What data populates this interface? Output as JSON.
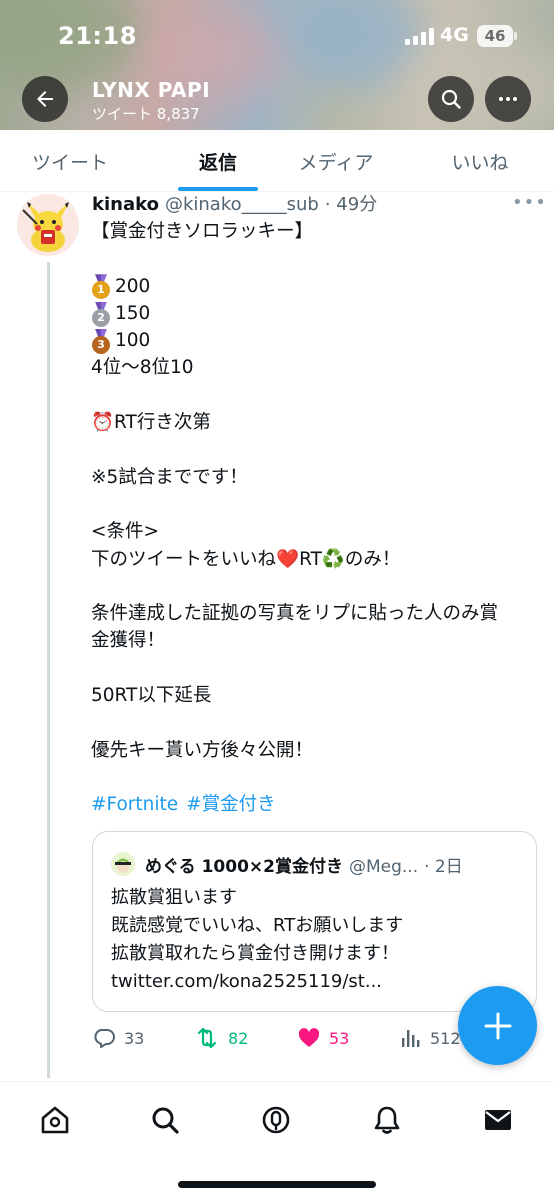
{
  "status_bar": {
    "time": "21:18",
    "network": "4G",
    "battery": "46"
  },
  "profile": {
    "name": "LYNX PAPI",
    "tweet_count": "ツイート 8,837"
  },
  "tabs": [
    {
      "label": "ツイート",
      "active": false
    },
    {
      "label": "返信",
      "active": true
    },
    {
      "label": "メディア",
      "active": false
    },
    {
      "label": "いいね",
      "active": false
    }
  ],
  "tweet": {
    "author_name": "kinako",
    "author_handle": "@kinako_____sub",
    "time": "· 49分",
    "lines": {
      "l1": "【賞金付きソロラッキー】",
      "l2": "200",
      "l3": "150",
      "l4": "100",
      "l5": "4位〜8位10",
      "l6_icon": "⏰",
      "l6": "RT行き次第",
      "l7": "※5試合までです！",
      "l8": "<条件>",
      "l9a": "下のツイートをいいね",
      "l9_heart": "❤️",
      "l9b": "RT",
      "l9_recycle": "♻️",
      "l9c": "のみ！",
      "l10": "条件達成した証拠の写真をリプに貼った人のみ賞",
      "l11": "金獲得！",
      "l12": "50RT以下延長",
      "l13": "優先キー貰い方後々公開！"
    },
    "hashtags": [
      "#Fortnite",
      "#賞金付き"
    ],
    "medals": {
      "gold_color": "#e3a21a",
      "silver_color": "#9aa0a6",
      "bronze_color": "#b5651d",
      "gold_num": "1",
      "silver_num": "2",
      "bronze_num": "3"
    },
    "quote": {
      "author_name": "めぐる 1000×2賞金付き",
      "author_handle": "@Meg...",
      "time": "· 2日",
      "lines": [
        "拡散賞狙います",
        "既読感覚でいいね、RTお願いします",
        "拡散賞取れたら賞金付き開けます！",
        "twitter.com/kona2525119/st..."
      ]
    },
    "stats": {
      "replies": "33",
      "retweets": "82",
      "likes": "53",
      "views": "512"
    }
  },
  "colors": {
    "accent": "#1d9bf0",
    "retweet": "#00ba7c",
    "like": "#f91880",
    "muted": "#536471"
  },
  "icons": {
    "back": "arrow-left-icon",
    "search": "search-icon",
    "more": "more-horizontal-icon",
    "compose": "plus-icon",
    "nav": [
      "home-icon",
      "search-icon",
      "spaces-icon",
      "notifications-bell-icon",
      "messages-envelope-icon"
    ]
  }
}
